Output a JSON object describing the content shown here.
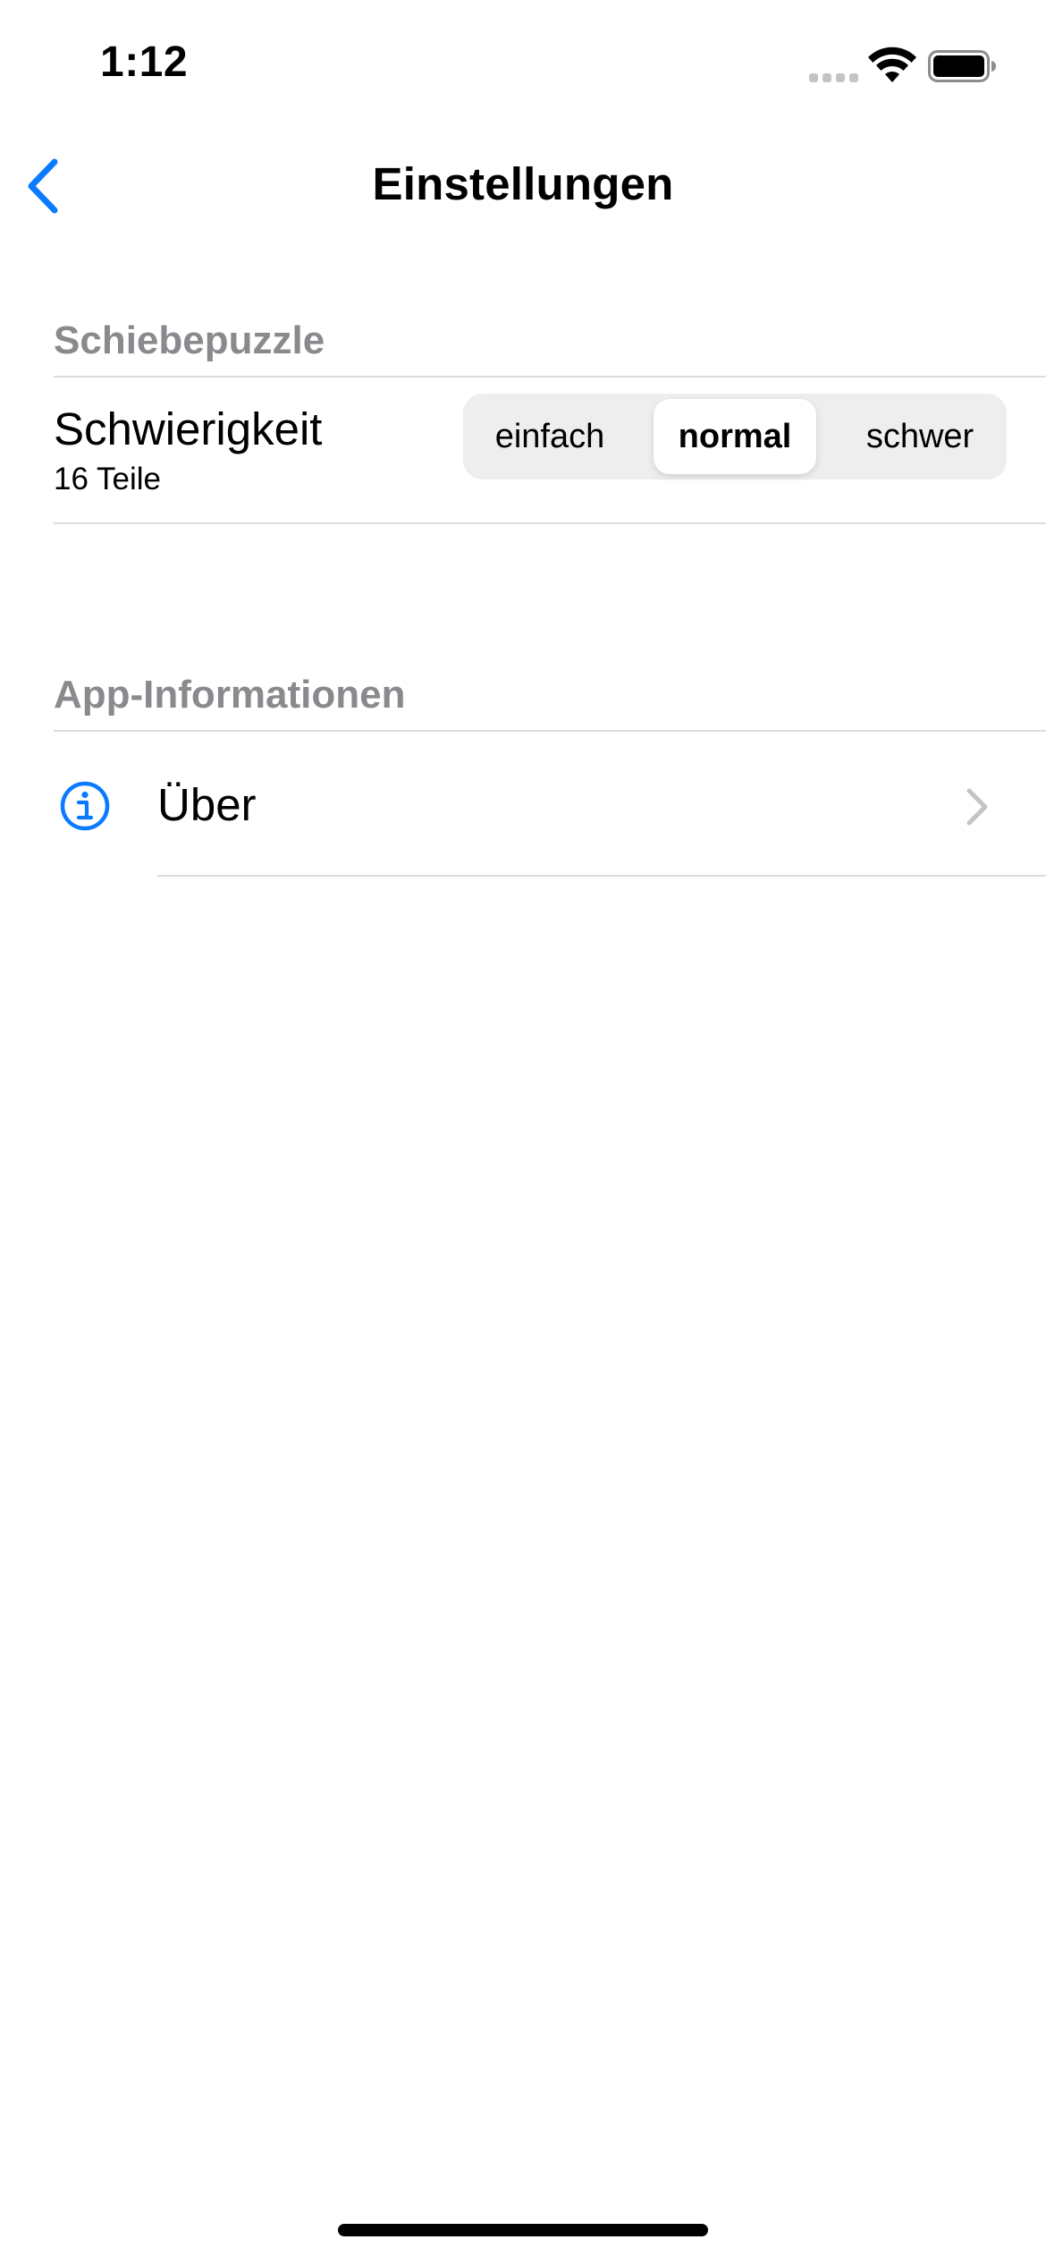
{
  "status_bar": {
    "time": "1:12"
  },
  "nav": {
    "title": "Einstellungen",
    "back_icon": "chevron-left-icon"
  },
  "sections": {
    "puzzle": {
      "header": "Schiebepuzzle",
      "difficulty": {
        "label": "Schwierigkeit",
        "subtitle": "16 Teile",
        "options": [
          "einfach",
          "normal",
          "schwer"
        ],
        "selected": "normal"
      }
    },
    "app_info": {
      "header": "App-Informationen",
      "about": {
        "label": "Über",
        "icon": "info-icon",
        "accessory": "chevron-right-icon"
      }
    }
  },
  "colors": {
    "accent": "#0a7aff",
    "secondary_text": "#8a8a8e",
    "separator": "#dcdcde",
    "segment_bg": "#eeeeef",
    "chevron": "#c4c4c7"
  }
}
